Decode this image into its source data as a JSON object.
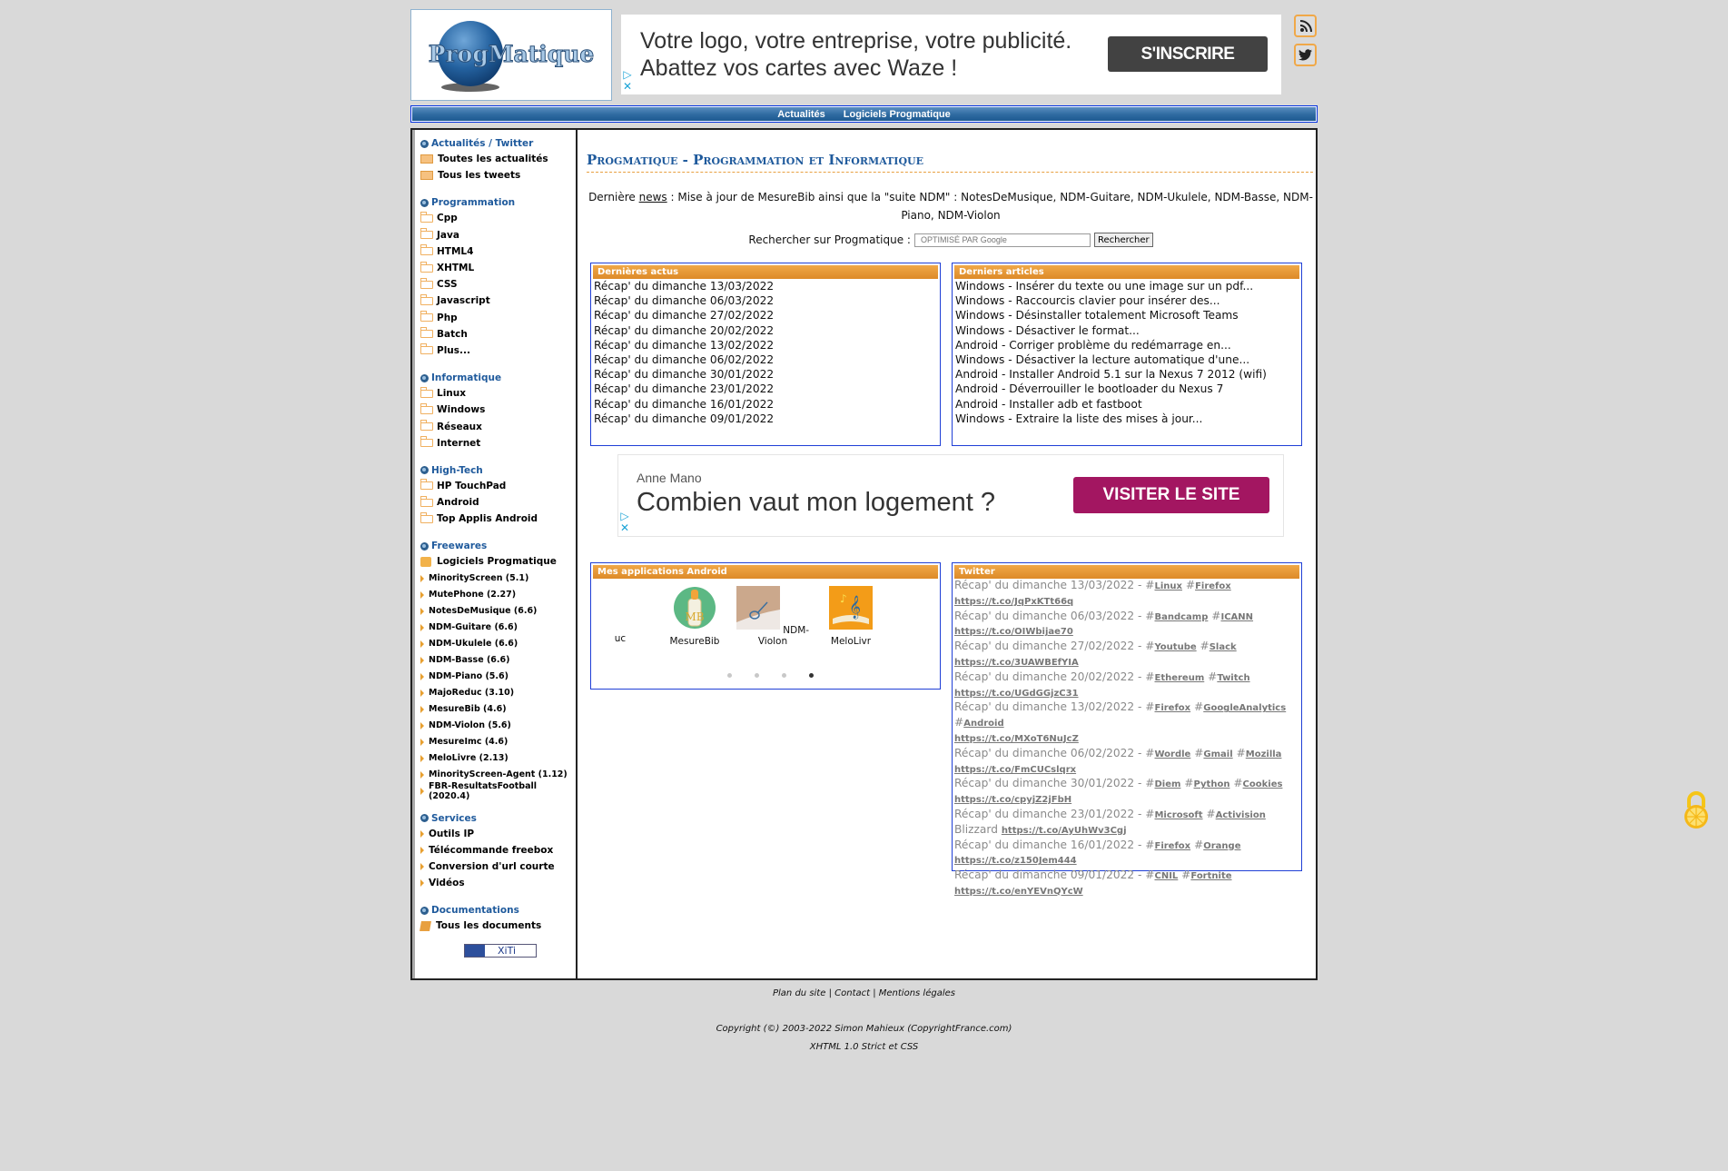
{
  "header": {
    "logo_text": "ProgMatique",
    "ad_top": {
      "text": "Votre logo, votre entreprise, votre publicité. Abattez vos cartes avec Waze !",
      "button": "S'INSCRIRE",
      "adchoices_icon": "adchoices-icon",
      "close_icon": "close-icon"
    },
    "social": [
      {
        "name": "rss",
        "icon": "rss-icon"
      },
      {
        "name": "twitter",
        "icon": "twitter-icon"
      }
    ]
  },
  "nav": {
    "items": [
      "Actualités",
      "Logiciels Progmatique"
    ]
  },
  "sidebar": {
    "sections": [
      {
        "title": "Actualités / Twitter",
        "items": [
          "Toutes les actualités",
          "Tous les tweets"
        ]
      },
      {
        "title": "Programmation",
        "items": [
          "Cpp",
          "Java",
          "HTML4",
          "XHTML",
          "CSS",
          "Javascript",
          "Php",
          "Batch",
          "Plus..."
        ]
      },
      {
        "title": "Informatique",
        "items": [
          "Linux",
          "Windows",
          "Réseaux",
          "Internet"
        ]
      },
      {
        "title": "High-Tech",
        "items": [
          "HP TouchPad",
          "Android",
          "Top Applis Android"
        ]
      },
      {
        "title": "Freewares",
        "main_item": "Logiciels Progmatique",
        "items": [
          "MinorityScreen (5.1)",
          "MutePhone (2.27)",
          "NotesDeMusique (6.6)",
          "NDM-Guitare (6.6)",
          "NDM-Ukulele (6.6)",
          "NDM-Basse (6.6)",
          "NDM-Piano (5.6)",
          "MajoReduc (3.10)",
          "MesureBib (4.6)",
          "NDM-Violon (5.6)",
          "MesureImc (4.6)",
          "MeloLivre (2.13)",
          "MinorityScreen-Agent (1.12)",
          "FBR-ResultatsFootball (2020.4)"
        ]
      },
      {
        "title": "Services",
        "items": [
          "Outils IP",
          "Télécommande freebox",
          "Conversion d'url courte",
          "Vidéos"
        ]
      },
      {
        "title": "Documentations",
        "items": [
          "Tous les documents"
        ]
      }
    ],
    "xiti_label": "XiTi"
  },
  "main": {
    "title": "Progmatique - Programmation et Informatique",
    "news": {
      "prefix": "Dernière ",
      "link": "news",
      "text": " : Mise à jour de MesureBib ainsi que la \"suite NDM\" : NotesDeMusique, NDM-Guitare, NDM-Ukulele, NDM-Basse, NDM-Piano, NDM-Violon"
    },
    "search": {
      "label": "Rechercher sur Progmatique :",
      "placeholder": "OPTIMISÉ PAR Google",
      "button": "Rechercher"
    },
    "actus": {
      "title": "Dernières actus",
      "items": [
        "Récap' du dimanche 13/03/2022",
        "Récap' du dimanche 06/03/2022",
        "Récap' du dimanche 27/02/2022",
        "Récap' du dimanche 20/02/2022",
        "Récap' du dimanche 13/02/2022",
        "Récap' du dimanche 06/02/2022",
        "Récap' du dimanche 30/01/2022",
        "Récap' du dimanche 23/01/2022",
        "Récap' du dimanche 16/01/2022",
        "Récap' du dimanche 09/01/2022"
      ]
    },
    "articles": {
      "title": "Derniers articles",
      "items": [
        "Windows - Insérer du texte ou une image sur un pdf...",
        "Windows - Raccourcis clavier pour insérer des...",
        "Windows - Désinstaller totalement Microsoft Teams",
        "Windows - Désactiver le format...",
        "Android - Corriger problème du redémarrage en...",
        "Windows - Désactiver la lecture automatique d'une...",
        "Android - Installer Android 5.1 sur la Nexus 7 2012 (wifi)",
        "Android - Déverrouiller le bootloader du Nexus 7",
        "Android - Installer adb et fastboot",
        "Windows - Extraire la liste des mises à jour..."
      ]
    },
    "ad_mid": {
      "advertiser": "Anne Mano",
      "headline": "Combien vaut mon logement ?",
      "button": "VISITER LE SITE"
    },
    "apps": {
      "title": "Mes applications Android",
      "items": [
        {
          "label": "uc",
          "partial": true
        },
        {
          "label": "MesureBib"
        },
        {
          "label": "NDM-Violon"
        },
        {
          "label": "MeloLivr",
          "partial": true
        }
      ],
      "carousel_pages": 4,
      "carousel_active": 4
    },
    "twitter": {
      "title": "Twitter",
      "tweets": [
        {
          "text": "Récap' du dimanche 13/03/2022 - ",
          "tags": [
            "Linux",
            "Firefox"
          ],
          "extra": "",
          "link": "https://t.co/JqPxKTt66q"
        },
        {
          "text": "Récap' du dimanche 06/03/2022 - ",
          "tags": [
            "Bandcamp",
            "ICANN"
          ],
          "extra": "",
          "link": "https://t.co/OIWbijae70"
        },
        {
          "text": "Récap' du dimanche 27/02/2022 - ",
          "tags": [
            "Youtube",
            "Slack"
          ],
          "extra": "",
          "link": "https://t.co/3UAWBEfYIA"
        },
        {
          "text": "Récap' du dimanche 20/02/2022 - ",
          "tags": [
            "Ethereum",
            "Twitch"
          ],
          "extra": "",
          "link": "https://t.co/UGdGGjzC31"
        },
        {
          "text": "Récap' du dimanche 13/02/2022 - ",
          "tags": [
            "Firefox",
            "GoogleAnalytics",
            "Android"
          ],
          "extra": "",
          "link": "https://t.co/MXoT6NuJcZ"
        },
        {
          "text": "Récap' du dimanche 06/02/2022 - ",
          "tags": [
            "Wordle",
            "Gmail",
            "Mozilla"
          ],
          "extra": "",
          "link": "https://t.co/FmCUCslqrx"
        },
        {
          "text": "Récap' du dimanche 30/01/2022 - ",
          "tags": [
            "Diem",
            "Python",
            "Cookies"
          ],
          "extra": "",
          "link": "https://t.co/cpyjZ2jFbH"
        },
        {
          "text": "Récap' du dimanche 23/01/2022 - ",
          "tags": [
            "Microsoft",
            "Activision"
          ],
          "extra": "Blizzard",
          "link": "https://t.co/AyUhWv3Cgj"
        },
        {
          "text": "Récap' du dimanche 16/01/2022 - ",
          "tags": [
            "Firefox",
            "Orange"
          ],
          "extra": "",
          "link": "https://t.co/z150Jem444"
        },
        {
          "text": "Récap' du dimanche 09/01/2022 - ",
          "tags": [
            "CNIL",
            "Fortnite"
          ],
          "extra": "",
          "link": "https://t.co/enYEVnQYcW"
        }
      ]
    }
  },
  "footer": {
    "links": [
      "Plan du site",
      "Contact",
      "Mentions légales"
    ],
    "separator": " | ",
    "copyright": "Copyright (©) 2003-2022 Simon Mahieux (CopyrightFrance.com)",
    "standard": "XHTML 1.0 Strict et CSS"
  },
  "colors": {
    "accent_blue": "#1f5a9c",
    "box_header_orange": "#e8962e",
    "box_border": "#1f3fd6",
    "background": "#d9d9d9"
  }
}
